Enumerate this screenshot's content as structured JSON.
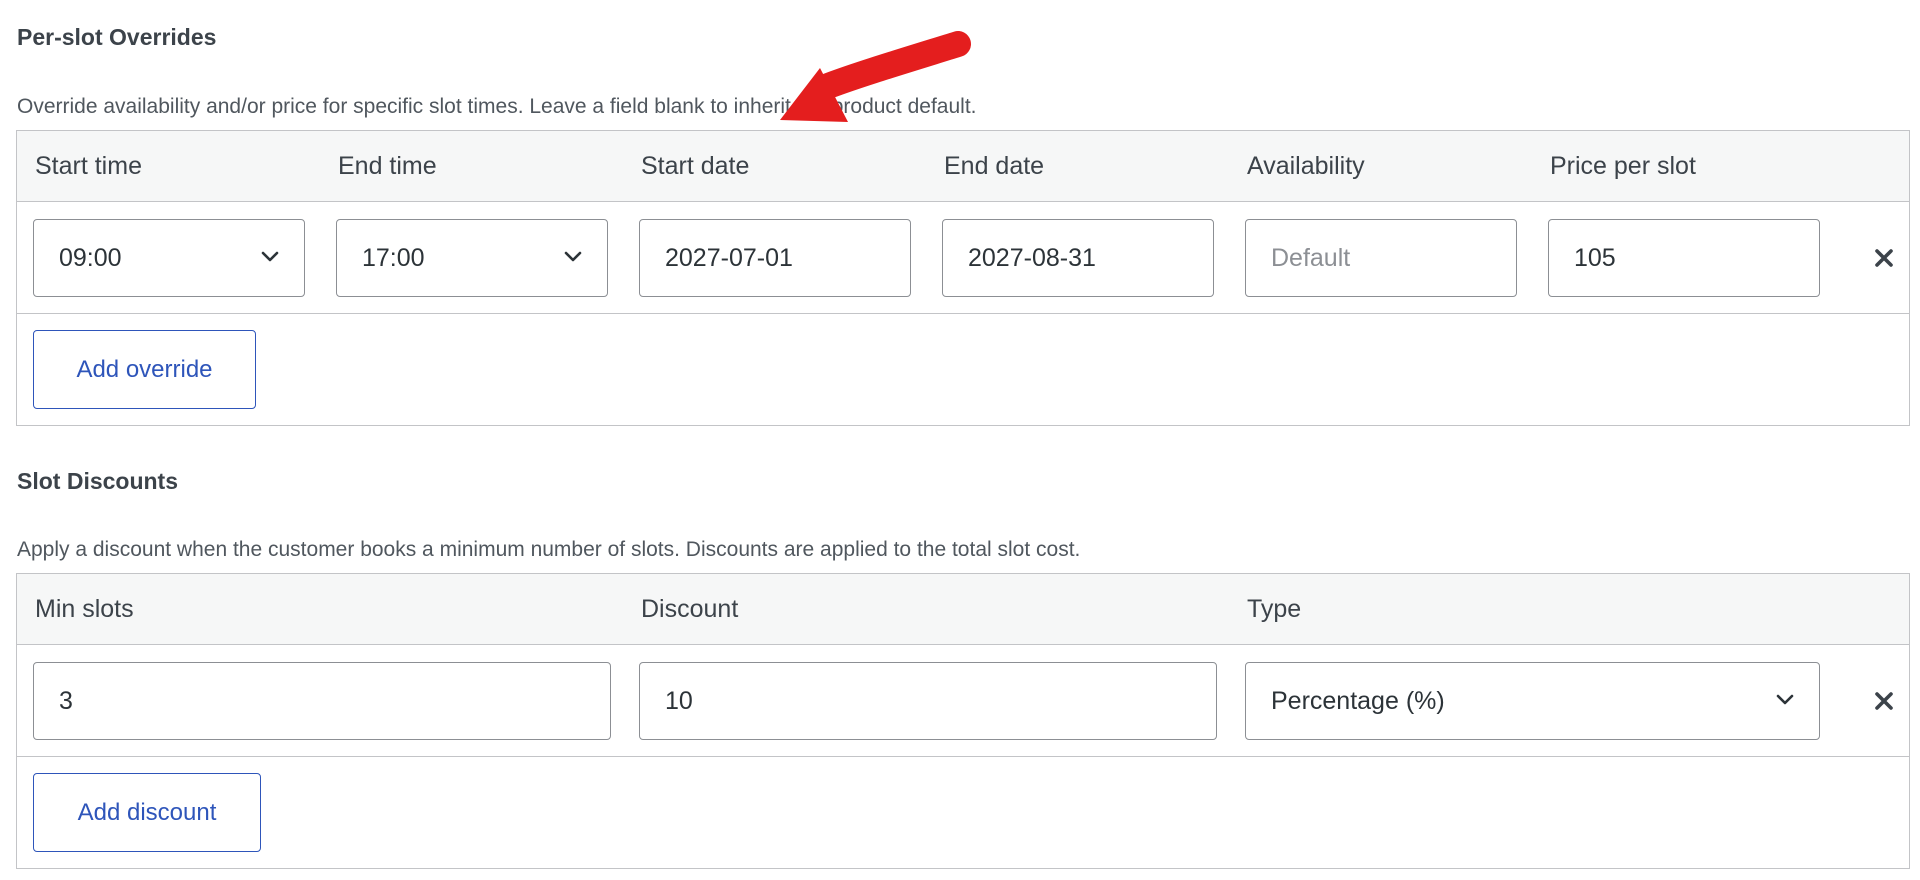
{
  "overrides": {
    "title": "Per-slot Overrides",
    "description": "Override availability and/or price for specific slot times. Leave a field blank to inherit the product default.",
    "columns": [
      "Start time",
      "End time",
      "Start date",
      "End date",
      "Availability",
      "Price per slot"
    ],
    "row": {
      "start_time": "09:00",
      "end_time": "17:00",
      "start_date": "2027-07-01",
      "end_date": "2027-08-31",
      "availability_placeholder": "Default",
      "price": "105"
    },
    "add_label": "Add override"
  },
  "discounts": {
    "title": "Slot Discounts",
    "description": "Apply a discount when the customer books a minimum number of slots. Discounts are applied to the total slot cost.",
    "columns": [
      "Min slots",
      "Discount",
      "Type"
    ],
    "row": {
      "min_slots": "3",
      "discount": "10",
      "type": "Percentage (%)"
    },
    "add_label": "Add discount"
  },
  "icons": {
    "remove": "close-icon",
    "dropdown": "chevron-down-icon",
    "annotation": "red-arrow-annotation"
  },
  "colors": {
    "accent": "#2e55ba",
    "annotation_arrow": "#e41e1e",
    "border": "#c3c4c7",
    "header_bg": "#f6f7f7"
  }
}
